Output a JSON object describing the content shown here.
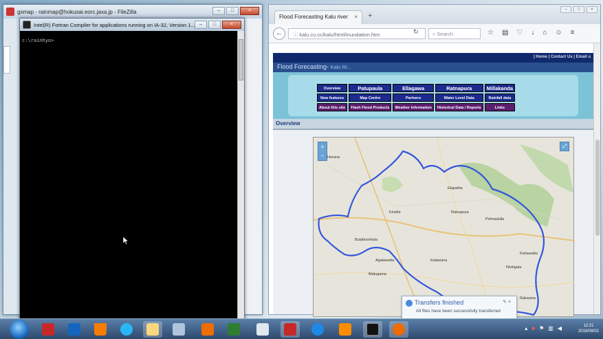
{
  "filezilla": {
    "title": "gsmap - rainmap@hokusai.eorc.jaxa.jp - FileZilla"
  },
  "console": {
    "title": "Intel(R) Fortran Compiler for applications running on IA-32, Version 1...",
    "prompt": "c:\\rainhyo>"
  },
  "firefox": {
    "tab_title": "Flood Forecasting Kalu river",
    "tab_close": "×",
    "new_tab": "+",
    "url": "kalu.cu.cc/kalu/html/inundation.htm",
    "search_placeholder": "Search"
  },
  "site": {
    "top_links": "| Home | Contact Us | Email u",
    "banner_title": "Flood Forecasting-",
    "banner_sub": "Kalu Ri...",
    "menu": [
      {
        "label": "Overview",
        "style": "normal"
      },
      {
        "label": "Patupaula",
        "style": "big"
      },
      {
        "label": "Ellagawa",
        "style": "big"
      },
      {
        "label": "Ratnapura",
        "style": "big"
      },
      {
        "label": "Millakanda",
        "style": "big"
      },
      {
        "label": "New features",
        "style": "normal"
      },
      {
        "label": "Map Centre",
        "style": "normal"
      },
      {
        "label": "Partners",
        "style": "normal"
      },
      {
        "label": "Water Level Data",
        "style": "normal"
      },
      {
        "label": "Rainfall data",
        "style": "normal"
      },
      {
        "label": "About this site",
        "style": "pur"
      },
      {
        "label": "Flash Flood Products",
        "style": "pur"
      },
      {
        "label": "Weather Information",
        "style": "pur"
      },
      {
        "label": "Historical Data / Reports",
        "style": "pur"
      },
      {
        "label": "Links",
        "style": "pur"
      }
    ],
    "section": "Overview",
    "map_labels": [
      "Horana",
      "Pelmadulla",
      "Ratnapura",
      "Kiriella",
      "Elapatha",
      "Matugama",
      "Bulathsinhala",
      "Kahawatta",
      "Agalawatta",
      "Nivitigala",
      "Rakwana",
      "Kalawana"
    ]
  },
  "toast": {
    "title": "Transfers finished",
    "body": "All files have been successfully transferred"
  },
  "clock": {
    "time": "12:21",
    "date": "2016/08/02"
  },
  "colors": {
    "site_navy": "#1d2b8e",
    "site_purple": "#5c1e6e",
    "basin_outline": "#3355dd"
  }
}
